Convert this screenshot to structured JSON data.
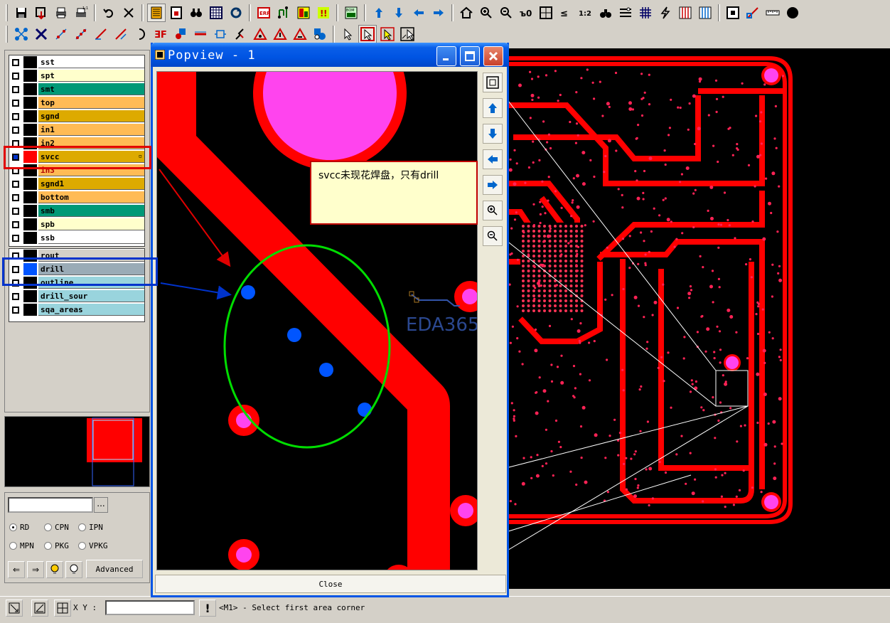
{
  "toolbar": {
    "row1": [
      "save-icon",
      "save-as-icon",
      "print-icon",
      "print-setup-icon",
      "undo-icon",
      "close-icon",
      "layer-list-icon",
      "select-icon",
      "find-icon",
      "spreadsheet-icon",
      "refresh-icon",
      "erf-icon",
      "netlist-icon",
      "report-icon",
      "drc-icon",
      "bom-icon",
      "arrow-up-icon",
      "arrow-down-icon",
      "arrow-left-icon",
      "arrow-right-icon",
      "home-icon",
      "zoom-in-icon",
      "zoom-out-icon",
      "zoom-ratio-icon",
      "zoom-box-icon",
      "zoom-sel-icon",
      "zoom-1-2-icon",
      "binoculars-icon",
      "filter-icon",
      "grid-icon",
      "lightning-icon",
      "stripes-icon",
      "stripes-2-icon",
      "frame-icon",
      "measure-icon",
      "ruler-icon",
      "fill-circle-icon"
    ],
    "row1_labels": {
      "erf": "ERF",
      "bom": "BOM",
      "zoom12": "1:2"
    },
    "row2": [
      "net-icon",
      "unroute-icon",
      "node-icon",
      "node2-icon",
      "line-icon",
      "line2-icon",
      "arc-icon",
      "flip-icon",
      "via-icon",
      "track-icon",
      "pad-icon",
      "probe-icon",
      "triangle-icon",
      "triangle2-icon",
      "triangle3-icon",
      "component-icon",
      "pointer-icon",
      "pointer-sel-icon",
      "pointer-frame-icon",
      "pointer-box-icon"
    ]
  },
  "layers": [
    {
      "name": "sst",
      "color": "#ffffff",
      "checked": false,
      "style": "normal"
    },
    {
      "name": "spt",
      "color": "#ffffcc",
      "checked": false,
      "style": "normal"
    },
    {
      "name": "smt",
      "color": "#009977",
      "checked": false,
      "style": "normal"
    },
    {
      "name": "top",
      "color": "#ffbb55",
      "checked": false,
      "style": "normal"
    },
    {
      "name": "sgnd",
      "color": "#ddaa00",
      "checked": false,
      "style": "normal"
    },
    {
      "name": "in1",
      "color": "#ffbb55",
      "checked": false,
      "style": "normal"
    },
    {
      "name": "in2",
      "color": "#ffbb55",
      "checked": false,
      "style": "normal"
    },
    {
      "name": "svcc",
      "color": "#ddaa00",
      "checked": true,
      "style": "selected"
    },
    {
      "name": "in3",
      "color": "#ffbb55",
      "checked": false,
      "style": "dim"
    },
    {
      "name": "sgnd1",
      "color": "#ddaa00",
      "checked": false,
      "style": "normal"
    },
    {
      "name": "bottom",
      "color": "#ffbb55",
      "checked": false,
      "style": "normal"
    },
    {
      "name": "smb",
      "color": "#009977",
      "checked": false,
      "style": "normal"
    },
    {
      "name": "spb",
      "color": "#ffffcc",
      "checked": false,
      "style": "normal"
    },
    {
      "name": "ssb",
      "color": "#ffffff",
      "checked": false,
      "style": "normal"
    }
  ],
  "layers2": [
    {
      "name": "rout",
      "color": "#d4d0c8",
      "checked": false
    },
    {
      "name": "drill",
      "color": "#9aabb6",
      "checked": false,
      "selected": true
    },
    {
      "name": "outline",
      "color": "#99d4dd",
      "checked": false
    },
    {
      "name": "drill_sour",
      "color": "#99d4dd",
      "checked": false
    },
    {
      "name": "sqa_areas",
      "color": "#99d4dd",
      "checked": false
    }
  ],
  "find": {
    "input_value": "",
    "dots_label": "...",
    "radios": [
      {
        "label": "RD",
        "on": true
      },
      {
        "label": "CPN",
        "on": false
      },
      {
        "label": "IPN",
        "on": false
      },
      {
        "label": "MPN",
        "on": false
      },
      {
        "label": "PKG",
        "on": false
      },
      {
        "label": "VPKG",
        "on": false
      }
    ],
    "advanced_label": "Advanced"
  },
  "popview": {
    "title": "Popview - 1",
    "close_label": "Close",
    "side_buttons": [
      "fit-view-icon",
      "pan-up-icon",
      "pan-down-icon",
      "pan-left-icon",
      "pan-right-icon",
      "zoom-in-icon",
      "zoom-out-icon"
    ]
  },
  "note": {
    "text": "svcc未现花焊盘，只有drill"
  },
  "watermark": "EDA365",
  "status": {
    "xy_label": "X Y :",
    "xy_value": "",
    "message": "<M1> - Select first area corner"
  },
  "colors": {
    "trace": "#ff0000",
    "pad_fill": "#ff44ee",
    "drill": "#0055ff",
    "annot_red": "#e00000",
    "annot_blue": "#0033cc",
    "annot_green": "#00dd00"
  }
}
